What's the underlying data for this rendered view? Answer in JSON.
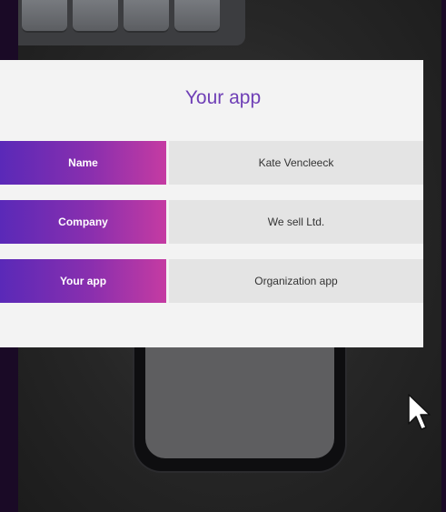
{
  "card": {
    "title": "Your app",
    "rows": [
      {
        "label": "Name",
        "value": "Kate Vencleeck"
      },
      {
        "label": "Company",
        "value": "We sell Ltd."
      },
      {
        "label": "Your app",
        "value": "Organization app"
      }
    ]
  },
  "colors": {
    "accent": "#6f3fb6",
    "gradient_start": "#5a29b8",
    "gradient_end": "#c53ba2",
    "page_border": "#1a0a26"
  },
  "icons": [
    "mouse-pointer-icon"
  ]
}
